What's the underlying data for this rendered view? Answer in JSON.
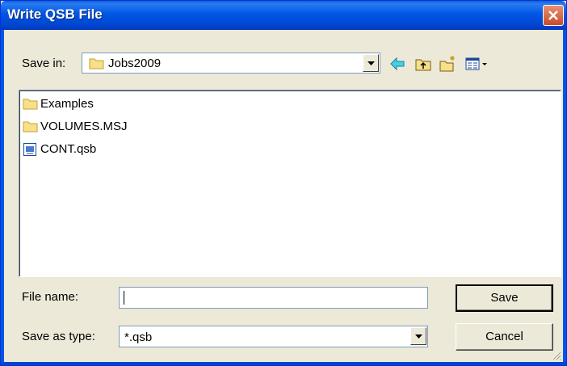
{
  "window": {
    "title": "Write QSB File"
  },
  "save_in": {
    "label": "Save in:",
    "value": "Jobs2009"
  },
  "files": [
    {
      "name": "Examples",
      "icon": "folder-icon"
    },
    {
      "name": "VOLUMES.MSJ",
      "icon": "folder-icon"
    },
    {
      "name": "CONT.qsb",
      "icon": "qsb-file-icon"
    }
  ],
  "file_name": {
    "label": "File name:",
    "value": ""
  },
  "save_type": {
    "label": "Save as type:",
    "value": "*.qsb"
  },
  "buttons": {
    "save": "Save",
    "cancel": "Cancel"
  },
  "colors": {
    "titlebar": "#0055e5",
    "face": "#ece9d8",
    "close": "#c94a2a"
  }
}
